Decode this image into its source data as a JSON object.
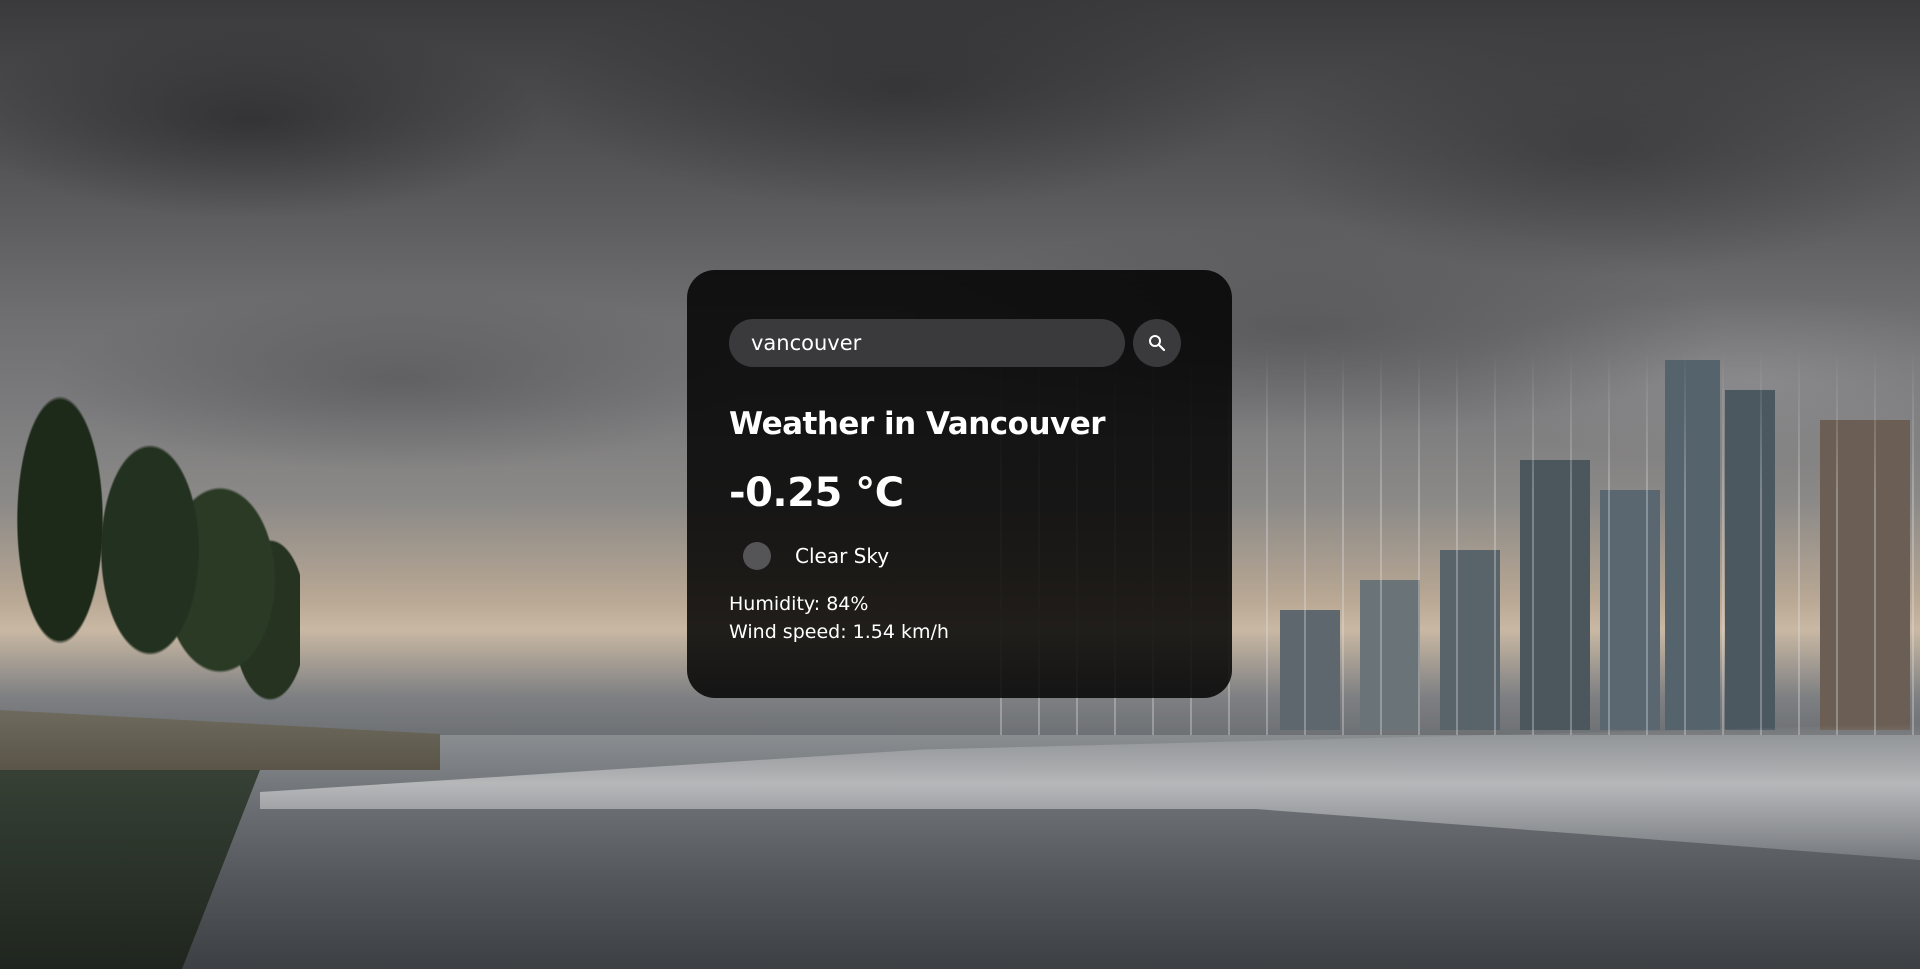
{
  "search": {
    "value": "vancouver",
    "button_icon": "search-icon"
  },
  "weather": {
    "title": "Weather in Vancouver",
    "temperature": "-0.25 °C",
    "icon": "clear-sky-icon",
    "description": "Clear Sky",
    "humidity": "Humidity: 84%",
    "wind": "Wind speed: 1.54 km/h"
  },
  "colors": {
    "card_background": "#000000",
    "input_background": "#3a3a3c",
    "text": "#ffffff"
  }
}
